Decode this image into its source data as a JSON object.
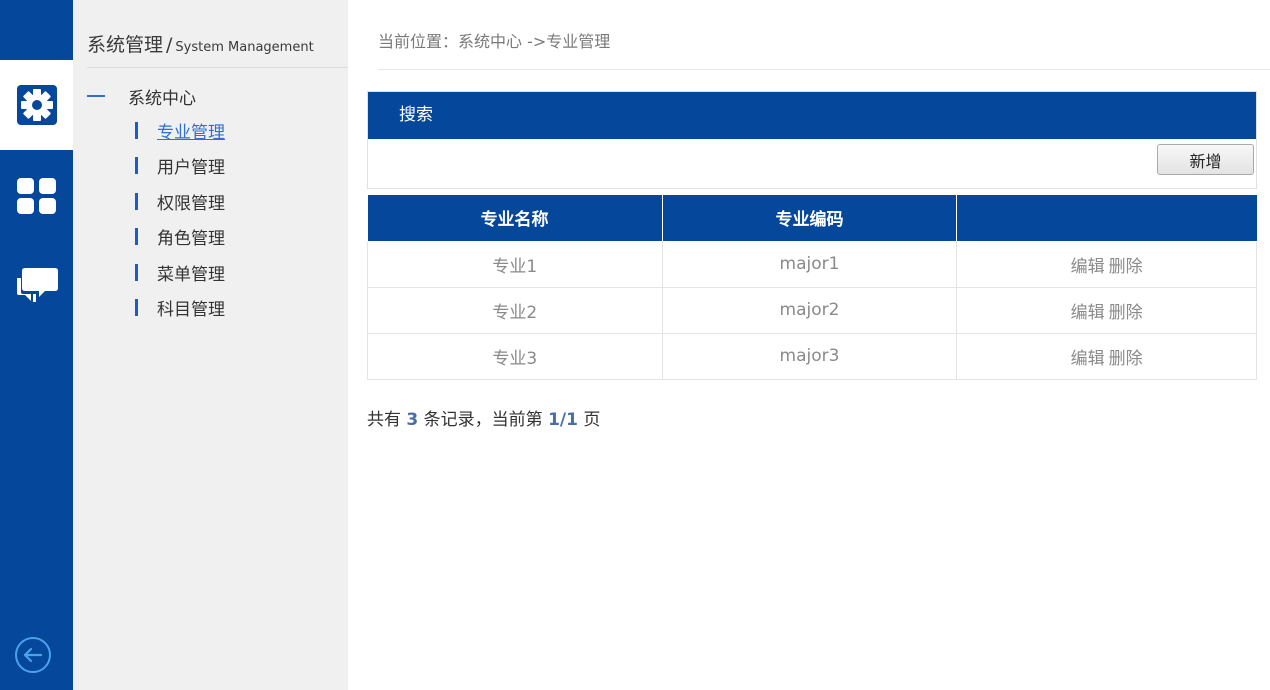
{
  "colors": {
    "primary": "#04479b",
    "side_bg": "#f0f0f0",
    "accent": "#2f6fd0"
  },
  "rail": {
    "items": [
      {
        "icon": "gear-icon",
        "active": true
      },
      {
        "icon": "grid-icon",
        "active": false
      },
      {
        "icon": "chat-icon",
        "active": false
      }
    ],
    "back_icon": "back-arrow-icon"
  },
  "sidebar": {
    "title": "系统管理",
    "subtitle": "System Management",
    "group": "系统中心",
    "items": [
      {
        "label": "专业管理",
        "active": true
      },
      {
        "label": "用户管理",
        "active": false
      },
      {
        "label": "权限管理",
        "active": false
      },
      {
        "label": "角色管理",
        "active": false
      },
      {
        "label": "菜单管理",
        "active": false
      },
      {
        "label": "科目管理",
        "active": false
      }
    ]
  },
  "breadcrumb": "当前位置：系统中心 ->专业管理",
  "search": {
    "title": "搜索",
    "add_label": "新增"
  },
  "table": {
    "columns": [
      "专业名称",
      "专业编码",
      ""
    ],
    "rows": [
      {
        "name": "专业1",
        "code": "major1",
        "edit": "编辑",
        "delete": "删除"
      },
      {
        "name": "专业2",
        "code": "major2",
        "edit": "编辑",
        "delete": "删除"
      },
      {
        "name": "专业3",
        "code": "major3",
        "edit": "编辑",
        "delete": "删除"
      }
    ]
  },
  "summary": {
    "prefix": "共有",
    "count": "3",
    "middle": "条记录，当前第",
    "page": "1/1",
    "suffix": "页"
  }
}
